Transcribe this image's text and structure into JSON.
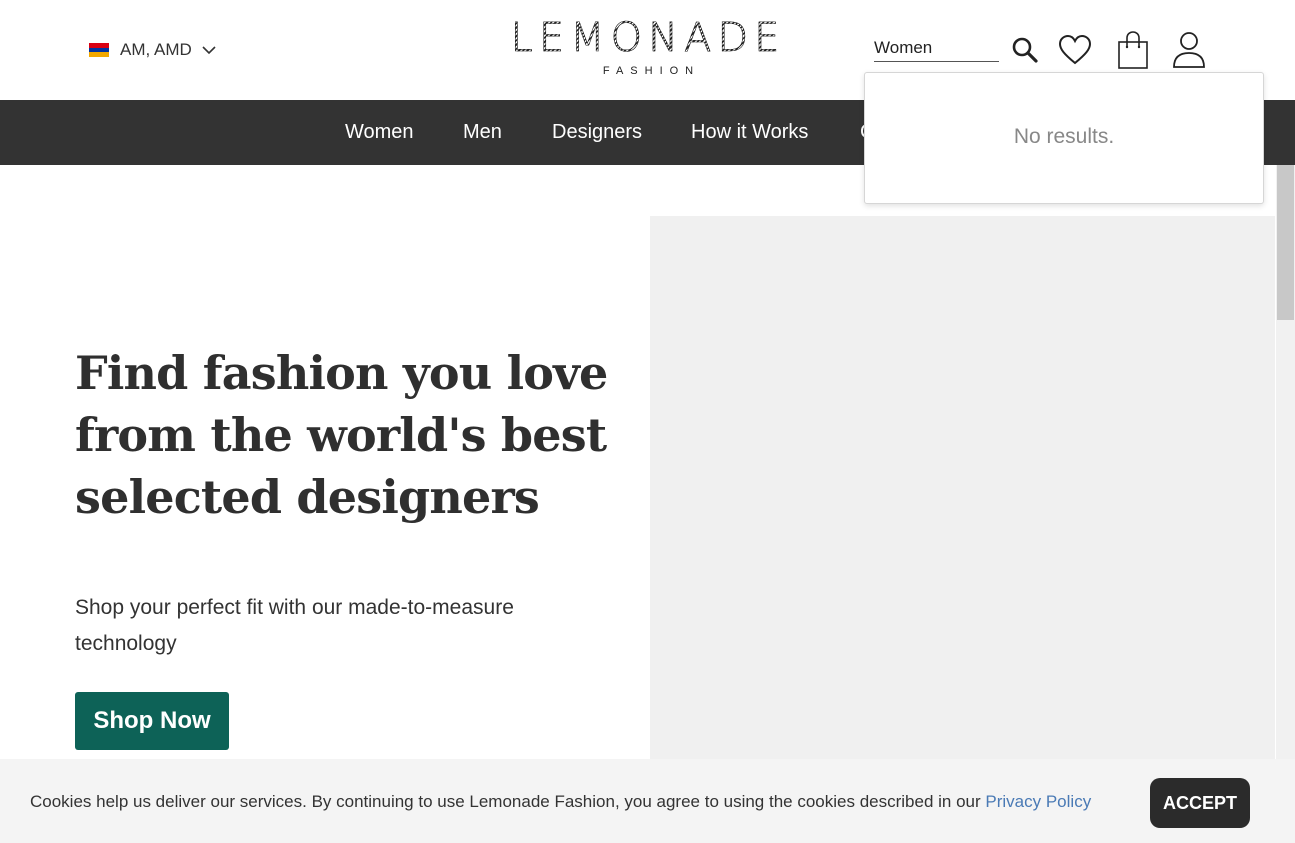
{
  "colors": {
    "nav_bg": "#333333",
    "accent": "#0d6257",
    "link": "#4a7ab5",
    "cookie_bg": "#f4f4f4",
    "hero_image_bg": "#f0f0f0"
  },
  "header": {
    "locale_label": "AM, AMD",
    "flag_icon": "armenia-flag-icon",
    "logo_main": "LEMONADE",
    "logo_sub": "FASHION",
    "search_value": "Women",
    "icons": [
      "search-icon",
      "heart-icon",
      "shopping-bag-icon",
      "user-icon"
    ]
  },
  "nav": {
    "items": [
      "Women",
      "Men",
      "Designers",
      "How it Works",
      "C"
    ]
  },
  "search_dropdown": {
    "message": "No results."
  },
  "hero": {
    "title_line1": "Find fashion you love",
    "title_line2": "from the world's best",
    "title_line3": "selected designers",
    "subtitle": "Shop your perfect fit with our made-to-measure technology",
    "cta": "Shop Now"
  },
  "cookie": {
    "text": "Cookies help us deliver our services. By continuing to use Lemonade Fashion, you agree to using the cookies described in our ",
    "link": "Privacy Policy",
    "accept": "ACCEPT"
  }
}
